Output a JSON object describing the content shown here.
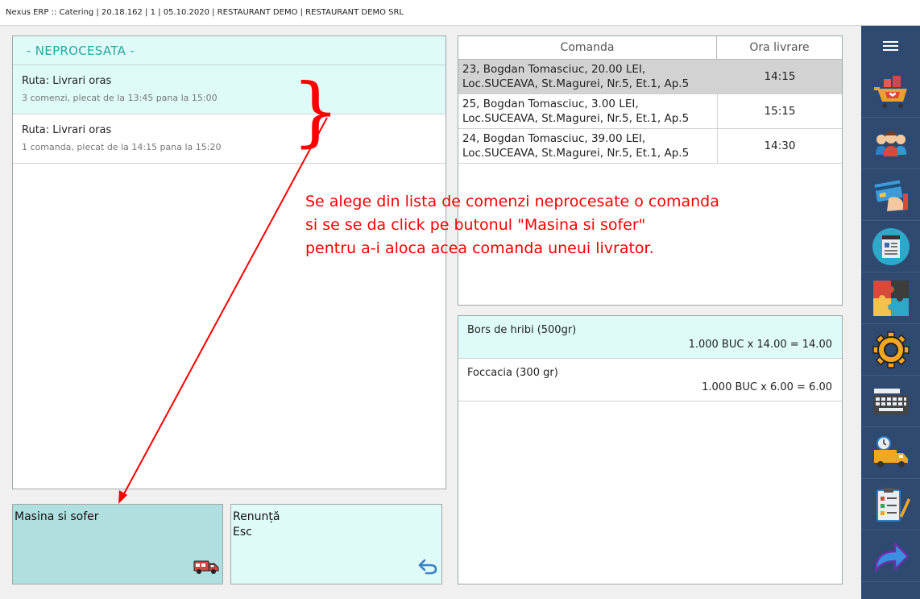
{
  "window": {
    "title": "Nexus ERP :: Catering | 20.18.162 | 1 | 05.10.2020 | RESTAURANT DEMO | RESTAURANT DEMO SRL"
  },
  "left_panel": {
    "header": "- NEPROCESATA -",
    "routes": [
      {
        "title": "Ruta: Livrari oras",
        "subtitle": "3 comenzi, plecat de la 13:45 pana la 15:00",
        "selected": true
      },
      {
        "title": "Ruta: Livrari oras",
        "subtitle": "1 comanda, plecat de la 14:15 pana la 15:20",
        "selected": false
      }
    ]
  },
  "buttons": {
    "masina": {
      "label": "Masina si sofer",
      "icon": "delivery-van-icon"
    },
    "renunta": {
      "label": "Renunță",
      "shortcut": "Esc",
      "icon": "undo-arrow-icon"
    }
  },
  "orders_panel": {
    "columns": [
      "Comanda",
      "Ora livrare"
    ],
    "rows": [
      {
        "line1": "23, Bogdan Tomasciuc, 20.00 LEI,",
        "line2": "Loc.SUCEAVA, St.Magurei, Nr.5, Et.1, Ap.5",
        "time": "14:15",
        "selected": true
      },
      {
        "line1": "25, Bogdan Tomasciuc, 3.00 LEI,",
        "line2": "Loc.SUCEAVA, St.Magurei, Nr.5, Et.1, Ap.5",
        "time": "15:15",
        "selected": false
      },
      {
        "line1": "24, Bogdan Tomasciuc, 39.00 LEI,",
        "line2": "Loc.SUCEAVA, St.Magurei, Nr.5, Et.1, Ap.5",
        "time": "14:30",
        "selected": false
      }
    ]
  },
  "items_panel": {
    "rows": [
      {
        "name": "Bors de hribi (500gr)",
        "calc": "1.000 BUC x 14.00 = 14.00",
        "selected": true
      },
      {
        "name": "Foccacia (300 gr)",
        "calc": "1.000 BUC x 6.00 = 6.00",
        "selected": false
      }
    ]
  },
  "annotation": {
    "lines": [
      "Se alege din lista de comenzi neprocesate o comanda",
      "si se se da click pe butonul \"Masina si sofer\"",
      "pentru a-i aloca acea comanda uneui livrator."
    ],
    "brace": "}",
    "color": "#ff0000"
  },
  "sidebar": {
    "items": [
      {
        "icon": "menu-icon"
      },
      {
        "icon": "shopping-cart-icon"
      },
      {
        "icon": "customers-icon"
      },
      {
        "icon": "payment-card-icon"
      },
      {
        "icon": "receipt-icon"
      },
      {
        "icon": "puzzle-icon"
      },
      {
        "icon": "gear-icon"
      },
      {
        "icon": "keyboard-icon"
      },
      {
        "icon": "delivery-truck-icon"
      },
      {
        "icon": "checklist-icon"
      },
      {
        "icon": "share-arrow-icon"
      }
    ]
  },
  "colors": {
    "accent_light": "#defbf8",
    "accent_button": "#afe0df",
    "accent_text": "#2aa5a0",
    "sidebar": "#2f4a71",
    "selected_row": "#d2d2d2"
  }
}
